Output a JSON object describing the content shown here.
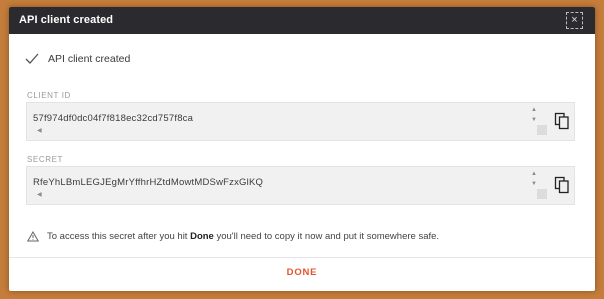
{
  "dialog": {
    "title": "API client created",
    "close_glyph": "×",
    "status_text": "API client created",
    "check_icon": "check-icon"
  },
  "client_id": {
    "label": "CLIENT ID",
    "value": "57f974df0dc04f7f818ec32cd757f8ca",
    "copy_icon": "copy-icon"
  },
  "secret": {
    "label": "SECRET",
    "value": "RfeYhLBmLEGJEgMrYffhrHZtdMowtMDSwFzxGlKQ",
    "copy_icon": "copy-icon"
  },
  "warning": {
    "prefix": "To access this secret after you hit ",
    "emphasis": "Done",
    "suffix": " you'll need to copy it now and put it somewhere safe."
  },
  "footer": {
    "done_label": "DONE"
  },
  "colors": {
    "titlebar": "#2b2b2f",
    "accent": "#e2532f",
    "backdrop": "#c47d3a"
  }
}
